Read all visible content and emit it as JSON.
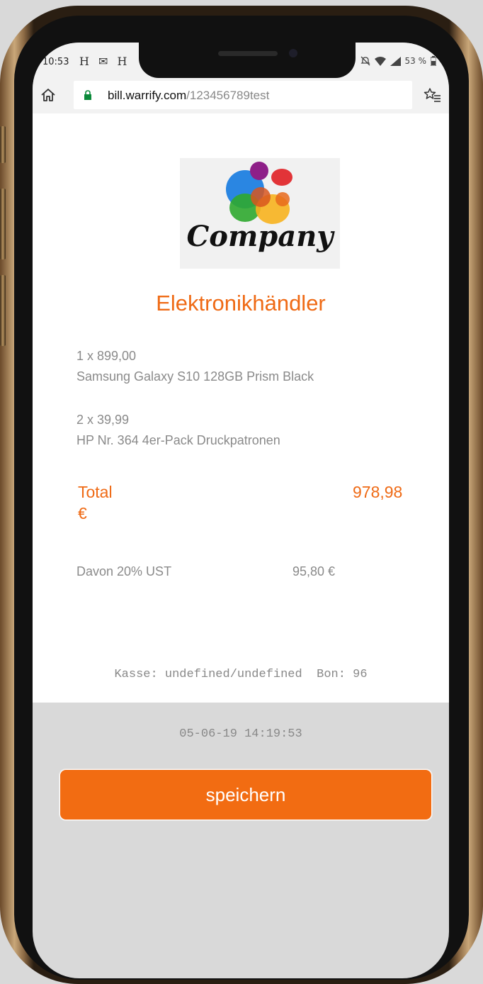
{
  "status_bar": {
    "time": "10:53",
    "left_icons": "H ✉ H",
    "battery": "53 %"
  },
  "browser": {
    "url_host": "bill.warrify.com",
    "url_path": "/123456789test"
  },
  "receipt": {
    "logo_text": "Company",
    "merchant_name": "Elektronikhändler",
    "items": [
      {
        "quantity_price": "1 x 899,00",
        "name": "Samsung Galaxy S10 128GB Prism Black"
      },
      {
        "quantity_price": "2 x 39,99",
        "name": "HP Nr. 364 4er-Pack Druckpatronen"
      }
    ],
    "total_label": "Total",
    "total_currency": "€",
    "total_value": "978,98",
    "tax_label": "Davon 20%  UST",
    "tax_value": "95,80 €",
    "register_line": "Kasse: undefined/undefined  Bon: 96",
    "datetime": "05-06-19 14:19:53"
  },
  "actions": {
    "save_label": "speichern"
  },
  "colors": {
    "accent": "#ef6a15",
    "button": "#f26c12",
    "muted_text": "#8a8a8a",
    "background": "#d9d9d9"
  },
  "icons": [
    "home-icon",
    "lock-icon",
    "bookmark-star-icon",
    "wifi-icon",
    "signal-icon",
    "battery-icon",
    "mute-icon"
  ]
}
